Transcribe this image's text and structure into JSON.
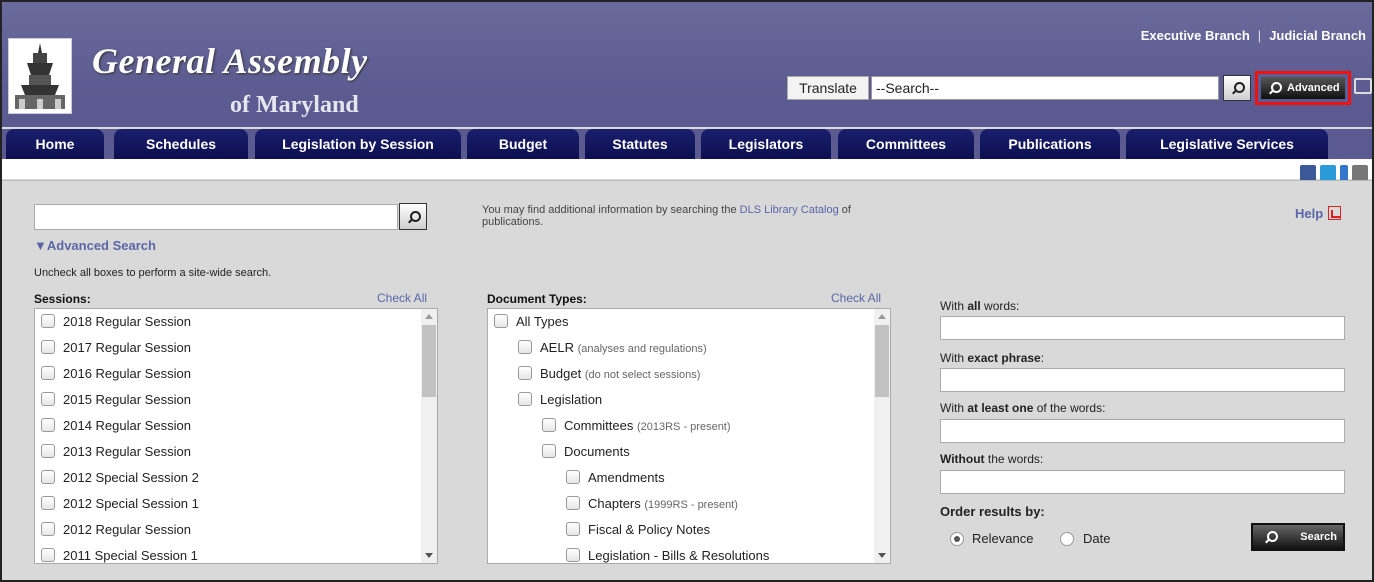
{
  "header": {
    "title": "General Assembly",
    "subtitle": "of Maryland",
    "branch_links": [
      "Executive Branch",
      "Judicial Branch"
    ],
    "translate_label": "Translate",
    "search_value": "--Search--",
    "advanced_label": "Advanced"
  },
  "nav": {
    "tabs": [
      "Home",
      "Schedules",
      "Legislation by Session",
      "Budget",
      "Statutes",
      "Legislators",
      "Committees",
      "Publications",
      "Legislative Services"
    ]
  },
  "search": {
    "advanced_toggle": "▼Advanced Search",
    "hint": "Uncheck all boxes to perform a site-wide search.",
    "dls_prefix": "You may find additional information by searching the ",
    "dls_link": "DLS Library Catalog",
    "dls_suffix": " of publications.",
    "help": "Help"
  },
  "sessions": {
    "label": "Sessions:",
    "check_all": "Check All",
    "items": [
      "2018 Regular Session",
      "2017 Regular Session",
      "2016 Regular Session",
      "2015 Regular Session",
      "2014 Regular Session",
      "2013 Regular Session",
      "2012 Special Session 2",
      "2012 Special Session 1",
      "2012 Regular Session",
      "2011 Special Session 1"
    ]
  },
  "doc_types": {
    "label": "Document Types:",
    "check_all": "Check All",
    "items": [
      {
        "label": "All Types",
        "note": ""
      },
      {
        "label": "AELR",
        "note": "(analyses and regulations)"
      },
      {
        "label": "Budget",
        "note": "(do not select sessions)"
      },
      {
        "label": "Legislation",
        "note": ""
      },
      {
        "label": "Committees",
        "note": "(2013RS - present)"
      },
      {
        "label": "Documents",
        "note": ""
      },
      {
        "label": "Amendments",
        "note": ""
      },
      {
        "label": "Chapters",
        "note": "(1999RS - present)"
      },
      {
        "label": "Fiscal & Policy Notes",
        "note": ""
      },
      {
        "label": "Legislation - Bills & Resolutions",
        "note": ""
      }
    ]
  },
  "advanced_fields": {
    "all_words_pre": "With ",
    "all_words_bold": "all",
    "all_words_post": " words:",
    "exact_pre": "With ",
    "exact_bold": "exact phrase",
    "exact_post": ":",
    "atleast_pre": "With ",
    "atleast_bold": "at least one",
    "atleast_post": " of the words:",
    "without_bold": "Without",
    "without_post": " the words:",
    "order_label": "Order results by:",
    "relevance": "Relevance",
    "date": "Date",
    "search_button": "Search"
  },
  "colors": {
    "header_bg": "#5e5d92",
    "nav_tab": "#0c0f4f",
    "link": "#5a66a8",
    "highlight": "#e11"
  }
}
